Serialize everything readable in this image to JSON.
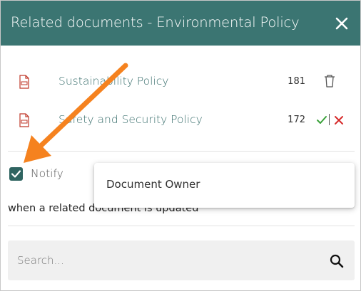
{
  "dialog": {
    "title": "Related documents - Environmental Policy",
    "close_icon": "close-icon"
  },
  "documents": [
    {
      "title": "Sustainability Policy",
      "count": "181",
      "icon": "pdf-document-icon",
      "action": "trash-icon"
    },
    {
      "title": "Safety and Security Policy",
      "count": "172",
      "icon": "pdf-document-icon",
      "action": "confirm-cancel"
    }
  ],
  "notify": {
    "checked": true,
    "label": "Notify",
    "description": "when a related document is updated",
    "selected_option": "Document Owner"
  },
  "search": {
    "placeholder": "Search...",
    "value": ""
  },
  "colors": {
    "header": "#3b7572",
    "link": "#3a6f6d",
    "confirm": "#3aa13a",
    "cancel": "#d62a2a",
    "annotation_arrow": "#f5821f"
  }
}
